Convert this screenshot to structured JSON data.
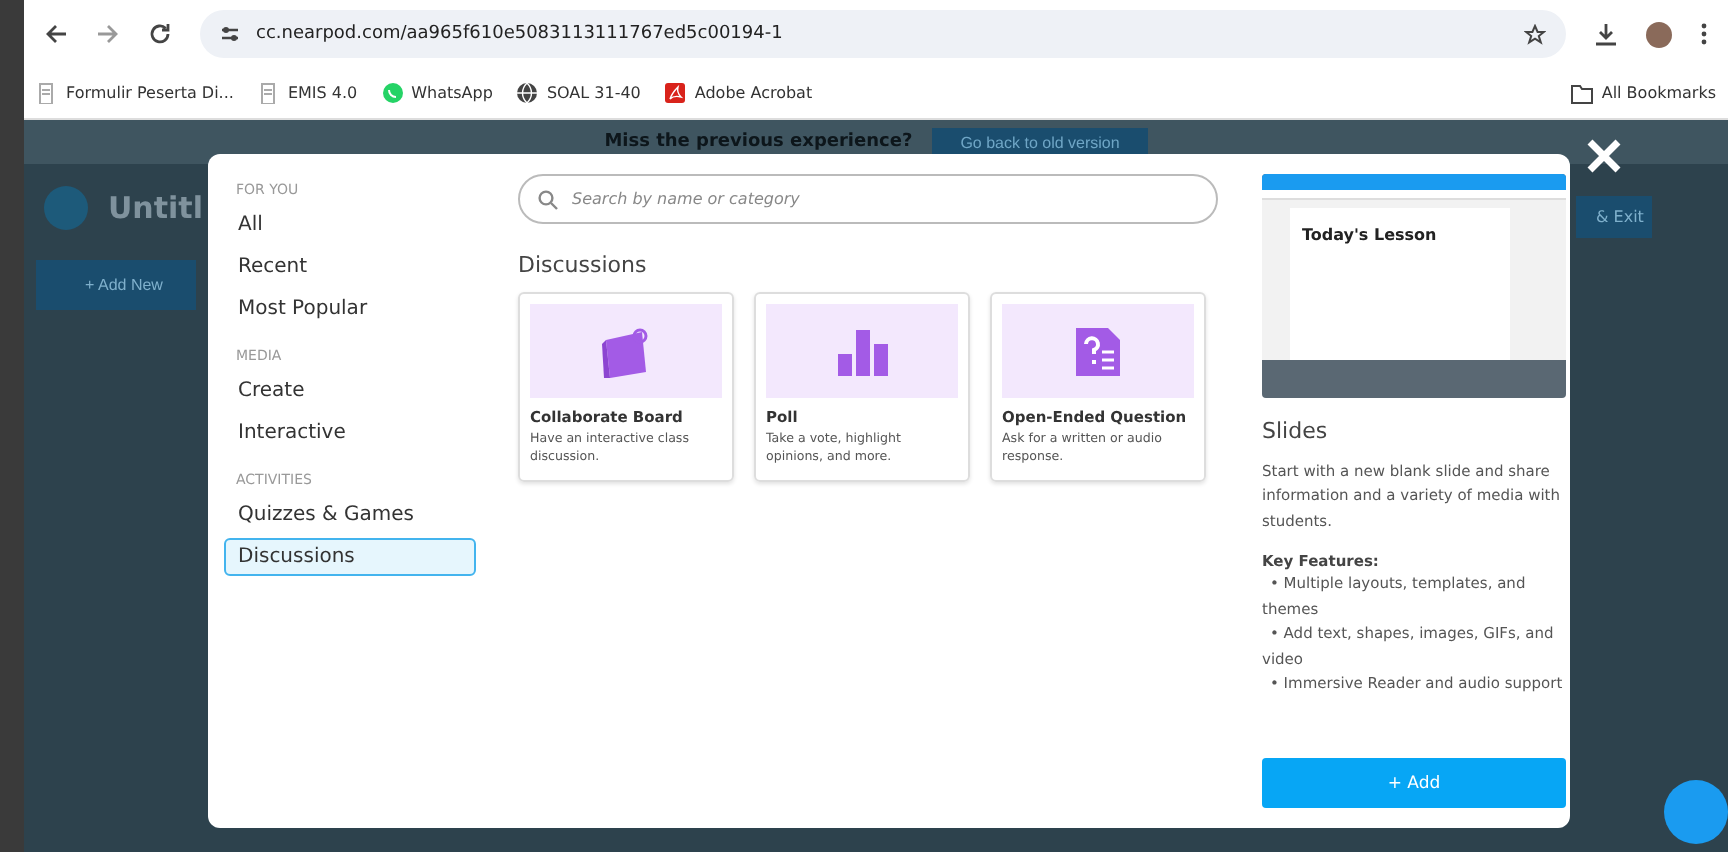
{
  "browser": {
    "url": "cc.nearpod.com/aa965f610e5083113111767ed5c00194-1",
    "bookmarks": [
      {
        "label": "Formulir Peserta Di...",
        "kind": "doc"
      },
      {
        "label": "EMIS 4.0",
        "kind": "doc"
      },
      {
        "label": "WhatsApp",
        "kind": "chat"
      },
      {
        "label": "SOAL 31-40",
        "kind": "globe"
      },
      {
        "label": "Adobe Acrobat",
        "kind": "pdf"
      }
    ],
    "all_bookmarks": "All Bookmarks"
  },
  "page_behind": {
    "banner": "Miss the previous experience?",
    "banner_button": "Go back to old version",
    "title": "Untitl",
    "add_new": "+ Add New",
    "exit": "& Exit"
  },
  "modal": {
    "nav": [
      {
        "heading": "FOR YOU",
        "items": [
          {
            "label": "All",
            "selected": false
          },
          {
            "label": "Recent",
            "selected": false
          },
          {
            "label": "Most Popular",
            "selected": false
          }
        ]
      },
      {
        "heading": "MEDIA",
        "items": [
          {
            "label": "Create",
            "selected": false
          },
          {
            "label": "Interactive",
            "selected": false
          }
        ]
      },
      {
        "heading": "ACTIVITIES",
        "items": [
          {
            "label": "Quizzes & Games",
            "selected": false
          },
          {
            "label": "Discussions",
            "selected": true
          }
        ]
      }
    ],
    "search": {
      "placeholder": "Search by name or category"
    },
    "section_title": "Discussions",
    "cards": [
      {
        "kind": "board",
        "title": "Collaborate Board",
        "description": "Have an interactive class discussion."
      },
      {
        "kind": "poll",
        "title": "Poll",
        "description": "Take a vote, highlight opinions, and more."
      },
      {
        "kind": "question",
        "title": "Open-Ended Question",
        "description": "Ask for a written or audio response."
      }
    ],
    "preview": {
      "thumbnail_title": "Today's Lesson",
      "title": "Slides",
      "description": "Start with a new blank slide and share information and a variety of media with students.",
      "features_heading": "Key Features:",
      "features": [
        "• Multiple layouts, templates, and themes",
        "• Add text, shapes, images, GIFs, and video",
        "• Immersive Reader and audio support"
      ],
      "add_button": "+ Add"
    }
  }
}
